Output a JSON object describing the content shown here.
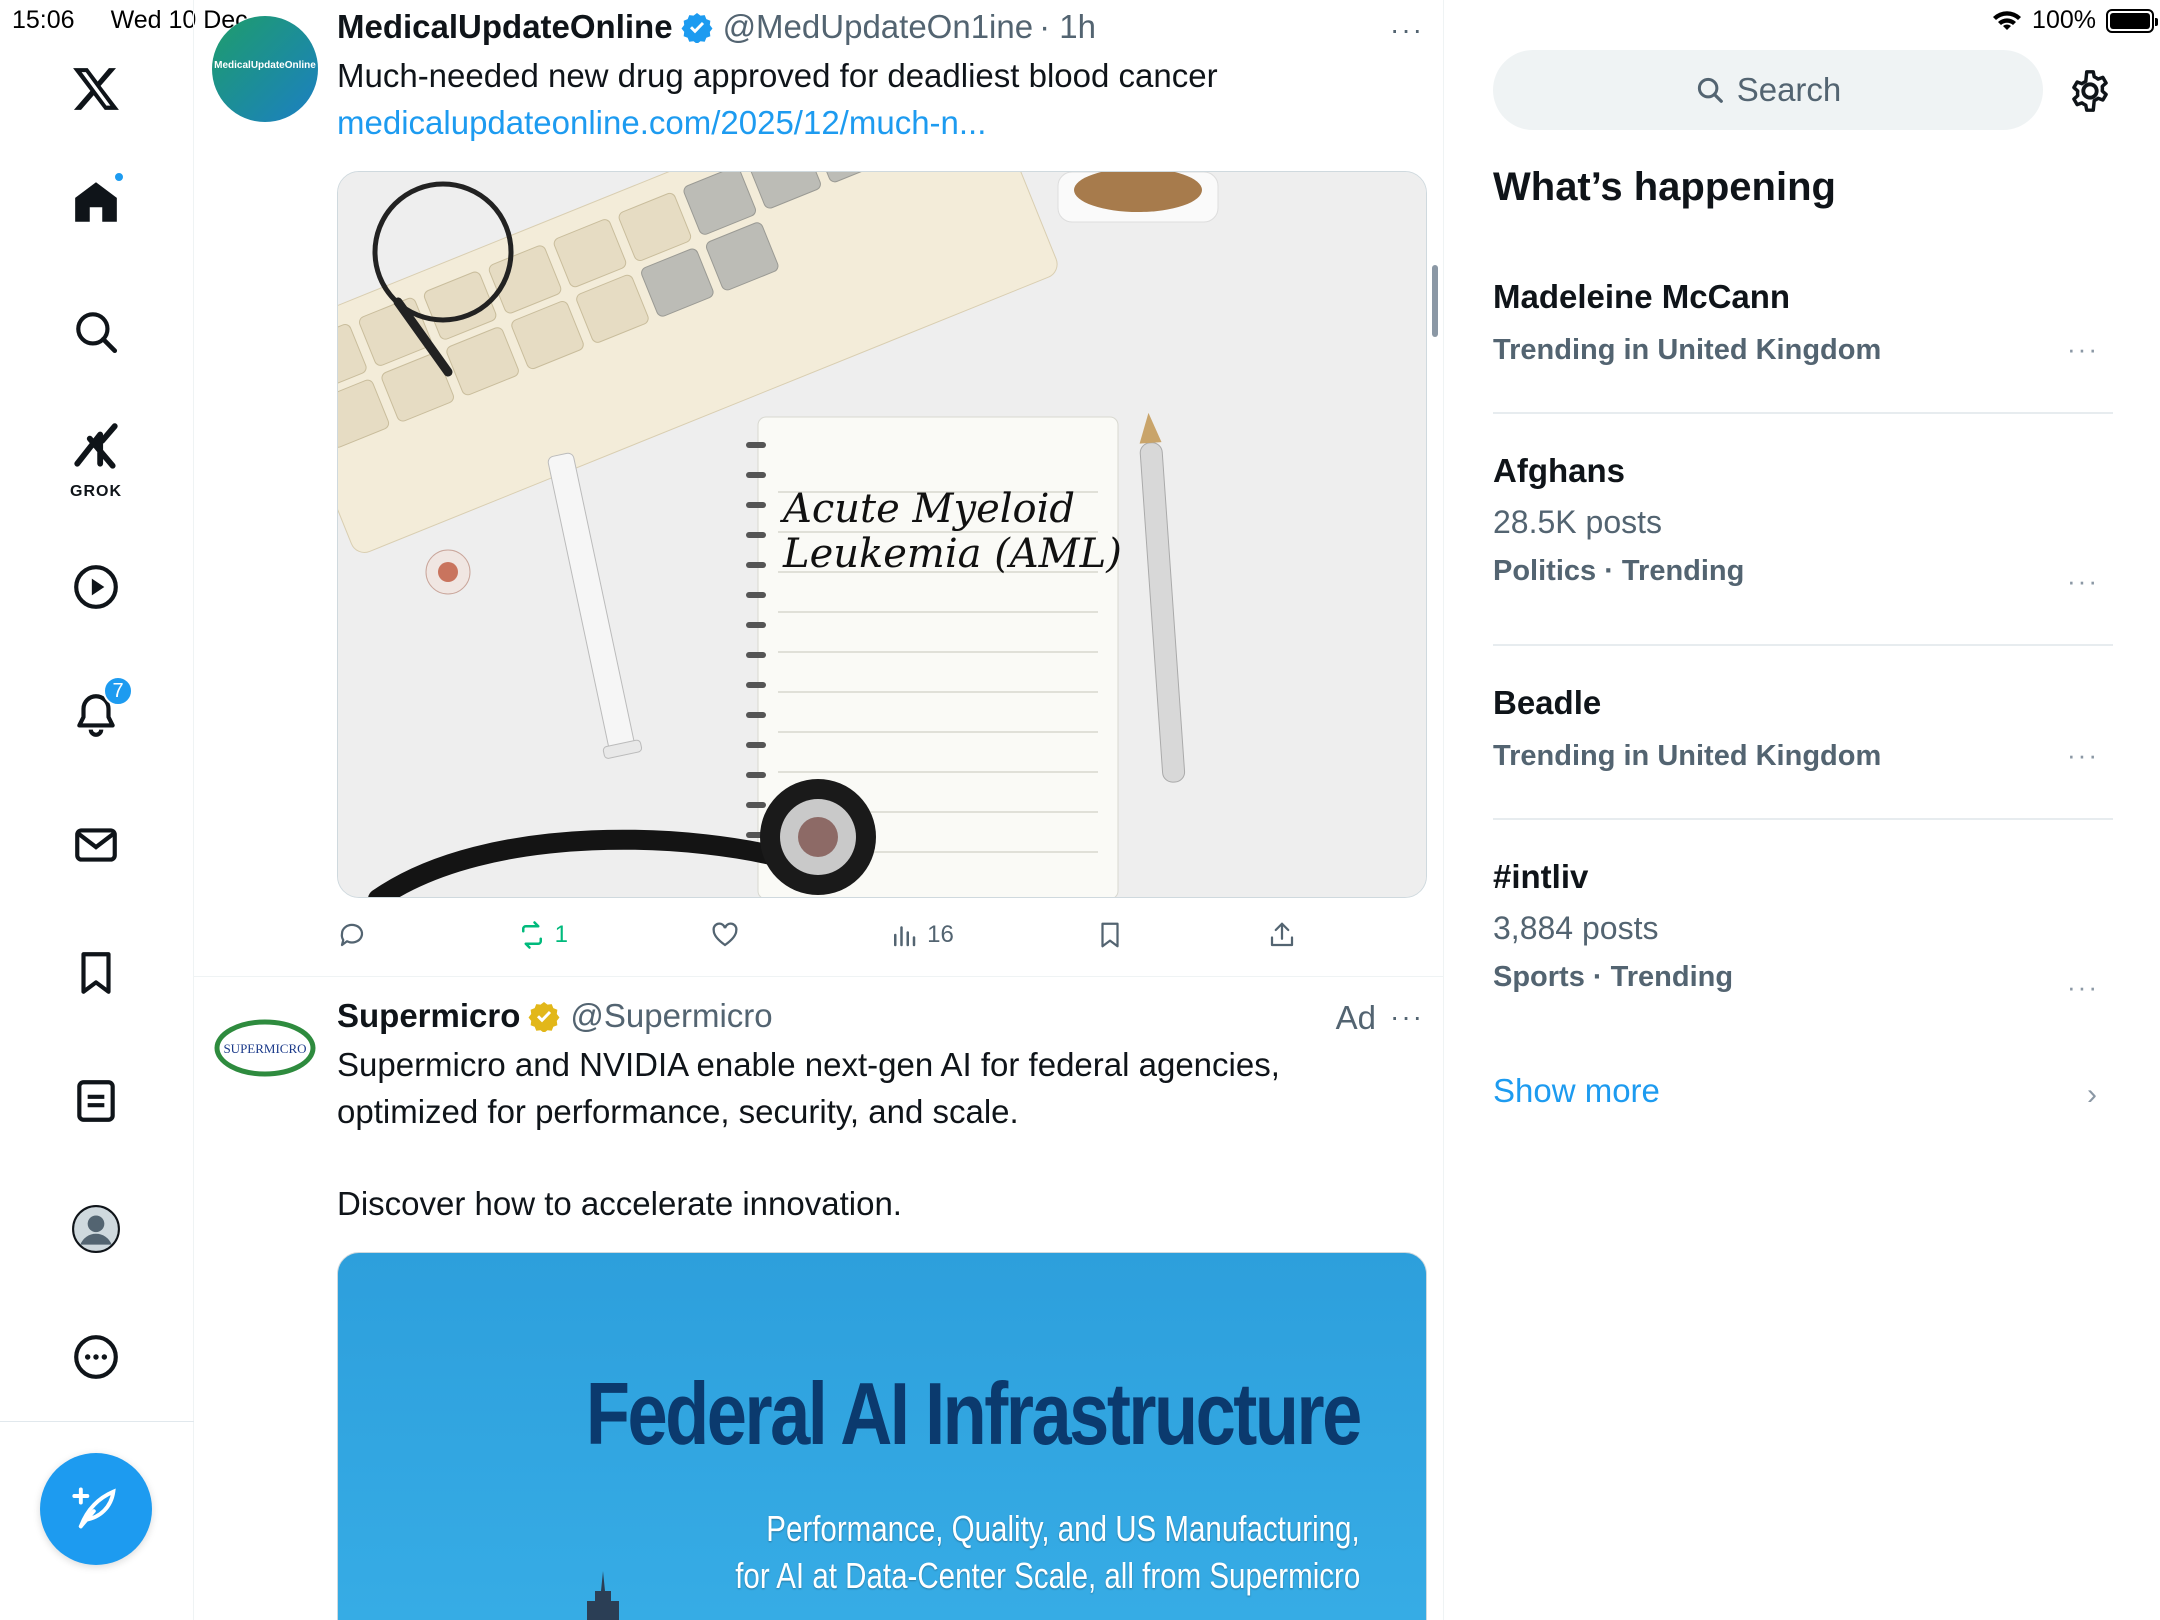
{
  "status_bar": {
    "time": "15:06",
    "date": "Wed 10 Dec",
    "battery": "100%"
  },
  "nav": {
    "items": [
      {
        "name": "x-logo"
      },
      {
        "name": "home"
      },
      {
        "name": "explore"
      },
      {
        "name": "grok",
        "label": "GROK"
      },
      {
        "name": "videos"
      },
      {
        "name": "notifications",
        "badge": "7"
      },
      {
        "name": "messages"
      },
      {
        "name": "bookmarks"
      },
      {
        "name": "lists"
      },
      {
        "name": "profile"
      },
      {
        "name": "more"
      }
    ]
  },
  "feed": {
    "tweet1": {
      "avatar_text": "MedicalUpdateOnline",
      "name": "MedicalUpdateOnline",
      "handle": "@MedUpdateOn1ine",
      "time": "· 1h",
      "text": "Much-needed new drug approved for deadliest blood cancer",
      "link": "medicalupdateonline.com/2025/12/much-n...",
      "image_text_line1": "Acute Myeloid",
      "image_text_line2": "Leukemia (AML)",
      "actions": {
        "reply": "",
        "repost": "1",
        "like": "",
        "views": "16"
      }
    },
    "tweet2": {
      "avatar_text": "SUPERMICRO",
      "name": "Supermicro",
      "handle": "@Supermicro",
      "ad_label": "Ad",
      "text_line1": "Supermicro and NVIDIA enable next-gen AI for federal agencies, optimized for performance, security, and scale.",
      "text_line2": "Discover how to accelerate innovation.",
      "banner_title": "Federal AI Infrastructure",
      "banner_sub1": "Performance, Quality, and US Manufacturing,",
      "banner_sub2": "for AI at Data-Center Scale, all from Supermicro"
    }
  },
  "sidebar": {
    "search_placeholder": "Search",
    "section_title": "What’s happening",
    "trends": [
      {
        "name": "Madeleine McCann",
        "posts": "",
        "meta": "Trending in United Kingdom"
      },
      {
        "name": "Afghans",
        "posts": "28.5K posts",
        "meta": "Politics · Trending"
      },
      {
        "name": "Beadle",
        "posts": "",
        "meta": "Trending in United Kingdom"
      },
      {
        "name": "#intliv",
        "posts": "3,884 posts",
        "meta": "Sports · Trending"
      }
    ],
    "show_more": "Show more"
  },
  "colors": {
    "accent": "#1d9bf0",
    "text": "#0f1419",
    "muted": "#536471",
    "repost_green": "#00ba7c",
    "banner_blue": "#2aa6e0",
    "banner_title": "#0b3a6e"
  }
}
